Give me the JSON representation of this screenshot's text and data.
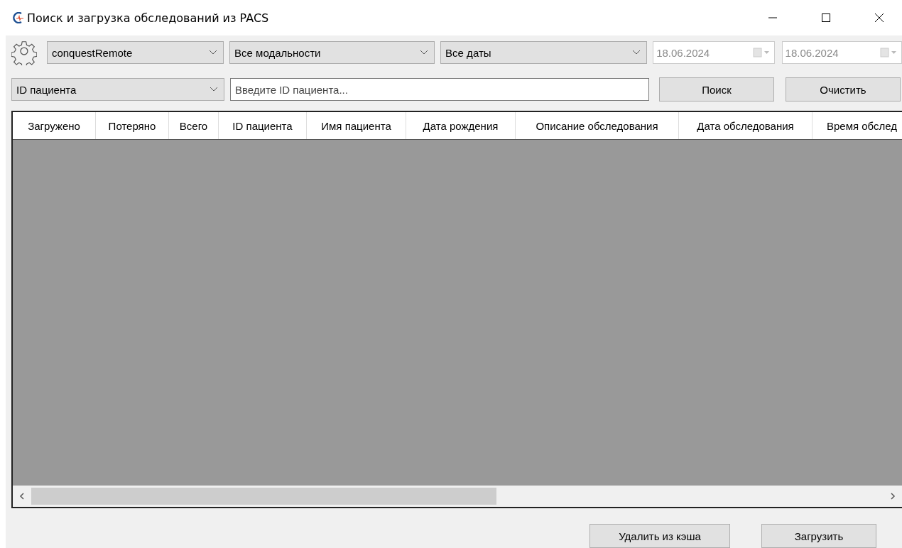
{
  "window": {
    "title": "Поиск и загрузка обследований из PACS"
  },
  "toolbar": {
    "server": {
      "value": "conquestRemote"
    },
    "modality": {
      "value": "Все модальности"
    },
    "date_mode": {
      "value": "Все даты"
    },
    "date_from": {
      "value": "18.06.2024",
      "disabled": true
    },
    "date_to": {
      "value": "18.06.2024",
      "disabled": true
    },
    "search_by": {
      "value": "ID пациента"
    },
    "search": {
      "placeholder": "Введите ID пациента..."
    },
    "buttons": [
      "Поиск",
      "Очистить"
    ]
  },
  "table": {
    "columns": [
      "Загружено",
      "Потеряно",
      "Всего",
      "ID пациента",
      "Имя пациента",
      "Дата рождения",
      "Описание обследования",
      "Дата обследования",
      "Время обслед"
    ]
  },
  "footer_buttons": [
    "Удалить из кэша",
    "Загрузить"
  ]
}
